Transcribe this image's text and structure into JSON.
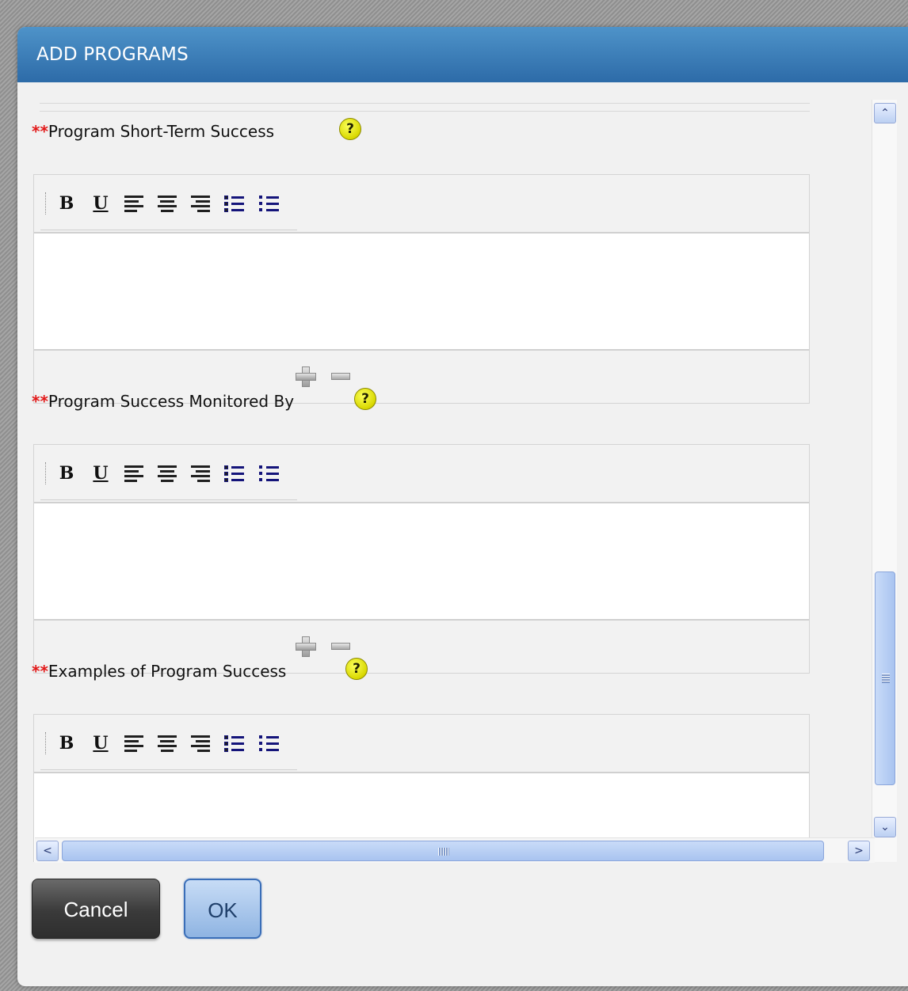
{
  "dialog": {
    "title": "ADD PROGRAMS",
    "accent_color": "#2d6ba8",
    "required_marker": "**",
    "help_glyph": "?",
    "fields": [
      {
        "label": "Program Short-Term Success",
        "help_icon": "help-icon",
        "content": ""
      },
      {
        "label": "Program Success Monitored By",
        "help_icon": "help-icon",
        "content": ""
      },
      {
        "label": "Examples of Program Success",
        "help_icon": "help-icon",
        "content": ""
      }
    ],
    "toolbar": {
      "bold": "B",
      "underline": "U",
      "icons": [
        "bold-icon",
        "underline-icon",
        "align-left-icon",
        "align-center-icon",
        "align-right-icon",
        "ordered-list-icon",
        "unordered-list-icon"
      ]
    },
    "footer_icons": [
      "plus-icon",
      "minus-icon"
    ],
    "scrollbars": {
      "up_glyph": "⌃",
      "down_glyph": "⌄",
      "left_glyph": "<",
      "right_glyph": ">"
    },
    "buttons": {
      "cancel": "Cancel",
      "ok": "OK"
    }
  }
}
